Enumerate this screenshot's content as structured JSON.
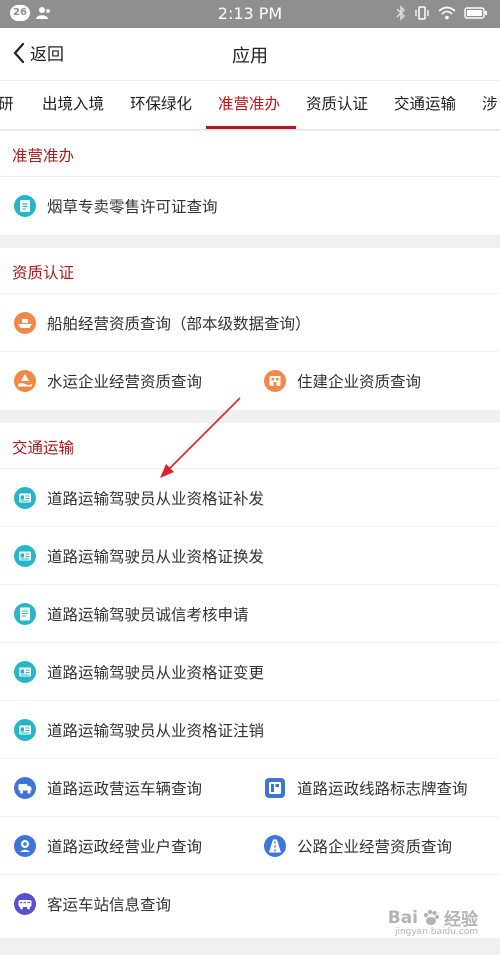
{
  "status_bar": {
    "notification_count": "26",
    "time": "2:13 PM"
  },
  "nav": {
    "back_label": "返回",
    "title": "应用"
  },
  "tabs": [
    {
      "label": "研"
    },
    {
      "label": "出境入境"
    },
    {
      "label": "环保绿化"
    },
    {
      "label": "准营准办",
      "active": true
    },
    {
      "label": "资质认证"
    },
    {
      "label": "交通运输"
    },
    {
      "label": "涉"
    }
  ],
  "sections": [
    {
      "title": "准营准办",
      "items": [
        {
          "label": "烟草专卖零售许可证查询",
          "icon": "tobacco-license-icon"
        }
      ]
    },
    {
      "title": "资质认证",
      "items": [
        {
          "label": "船舶经营资质查询（部本级数据查询）",
          "icon": "ship-qualification-icon"
        },
        {
          "label": "水运企业经营资质查询",
          "icon": "waterway-enterprise-icon"
        },
        {
          "label": "住建企业资质查询",
          "icon": "construction-enterprise-icon"
        }
      ]
    },
    {
      "title": "交通运输",
      "items": [
        {
          "label": "道路运输驾驶员从业资格证补发",
          "icon": "driver-certificate-icon"
        },
        {
          "label": "道路运输驾驶员从业资格证换发",
          "icon": "driver-certificate-icon"
        },
        {
          "label": "道路运输驾驶员诚信考核申请",
          "icon": "driver-certificate-icon"
        },
        {
          "label": "道路运输驾驶员从业资格证变更",
          "icon": "driver-certificate-icon"
        },
        {
          "label": "道路运输驾驶员从业资格证注销",
          "icon": "driver-certificate-icon"
        },
        {
          "label": "道路运政营运车辆查询",
          "icon": "vehicle-icon"
        },
        {
          "label": "道路运政线路标志牌查询",
          "icon": "route-sign-icon"
        },
        {
          "label": "道路运政经营业户查询",
          "icon": "operator-icon"
        },
        {
          "label": "公路企业经营资质查询",
          "icon": "highway-enterprise-icon"
        },
        {
          "label": "客运车站信息查询",
          "icon": "bus-station-icon"
        }
      ]
    }
  ],
  "watermark": {
    "brand": "Bai",
    "name": "经验",
    "url": "jingyan.baidu.com"
  },
  "colors": {
    "accent_red": "#c0141c",
    "section_title_red": "#a61a1e",
    "teal_icon": "#27b6c8",
    "orange_icon": "#f0884a",
    "blue_icon": "#3f76d6",
    "status_bar_gray": "#8f8f8f"
  }
}
